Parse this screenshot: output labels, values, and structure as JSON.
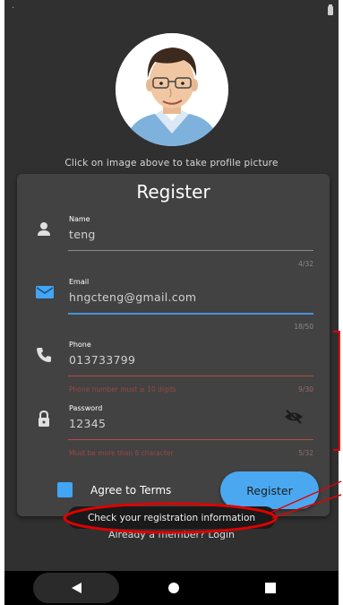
{
  "app": {
    "profile_hint": "Click on image above to take profile picture",
    "title": "Register"
  },
  "form": {
    "name": {
      "label": "Name",
      "value": "teng",
      "counter": "4/32",
      "icon": "person-icon"
    },
    "email": {
      "label": "Email",
      "value": "hngcteng@gmail.com",
      "counter": "18/50",
      "icon": "email-icon"
    },
    "phone": {
      "label": "Phone",
      "value": "013733799",
      "counter": "9/30",
      "error": "Phone number must ≥ 10 digits",
      "icon": "phone-icon"
    },
    "password": {
      "label": "Password",
      "value": "12345",
      "counter": "5/32",
      "error": "Must be more than 6 character",
      "icon": "lock-icon"
    }
  },
  "agree": {
    "label": "Agree to Terms",
    "checked": true
  },
  "register_button": "Register",
  "login_prompt": "Already a member? Login",
  "toast": "Check your registration information",
  "colors": {
    "background": "#303030",
    "card": "#424242",
    "accent": "#42a5f5",
    "error": "#b04848",
    "annotation": "#e00000"
  }
}
